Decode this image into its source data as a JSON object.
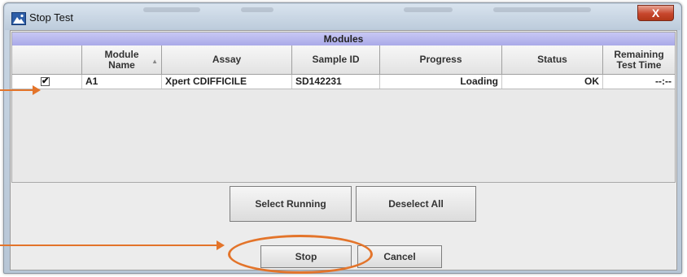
{
  "window": {
    "title": "Stop Test",
    "close_glyph": "X"
  },
  "table": {
    "section_title": "Modules",
    "columns": [
      "",
      "Module Name",
      "Assay",
      "Sample ID",
      "Progress",
      "Status",
      "Remaining Test Time"
    ],
    "rows": [
      {
        "selected": true,
        "check_glyph": "✔",
        "module": "A1",
        "assay": "Xpert CDIFFICILE",
        "sample_id": "SD142231",
        "progress": "Loading",
        "status": "OK",
        "remaining": "--:--"
      }
    ]
  },
  "buttons": {
    "select_running": "Select Running",
    "deselect_all": "Deselect All",
    "stop": "Stop",
    "cancel": "Cancel"
  },
  "colors": {
    "annotation_accent": "#e3742a",
    "modules_header": "#b0b0ec"
  },
  "icons": [
    "app-icon",
    "close-icon",
    "checkmark-icon",
    "sort-icon"
  ]
}
